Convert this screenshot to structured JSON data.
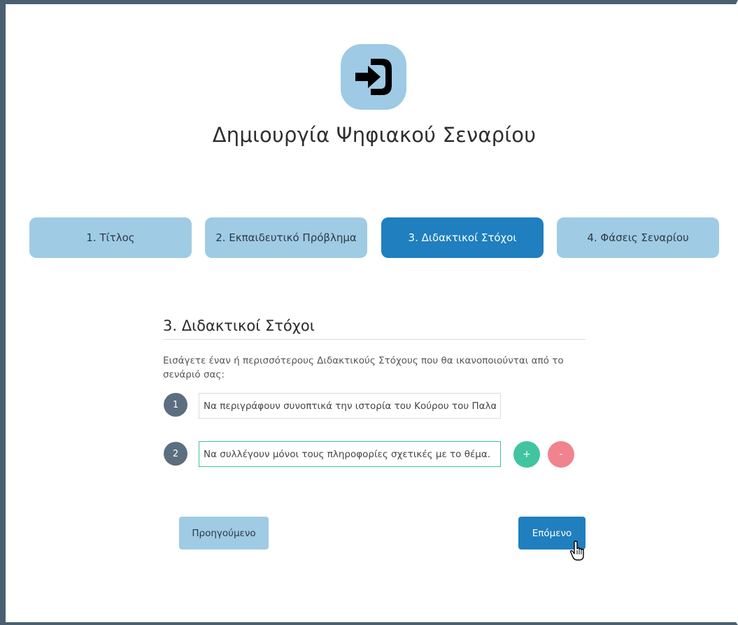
{
  "header": {
    "logo_icon": "login-arrow-icon",
    "title": "Δημιουργία Ψηφιακού Σεναρίου"
  },
  "steps": [
    {
      "label": "1. Τίτλος",
      "active": false
    },
    {
      "label": "2. Εκπαιδευτικό Πρόβλημα",
      "active": false
    },
    {
      "label": "3. Διδακτικοί Στόχοι",
      "active": true
    },
    {
      "label": "4. Φάσεις Σεναρίου",
      "active": false
    }
  ],
  "section": {
    "heading": "3. Διδακτικοί Στόχοι",
    "intro": "Εισάγετε έναν ή περισσότερους Διδακτικούς Στόχους που θα ικανοποιούνται από το σενάριό σας:"
  },
  "goals": [
    {
      "number": "1",
      "value": "Να περιγράφουν συνοπτικά την ιστορία του Κούρου του Παλαικ"
    },
    {
      "number": "2",
      "value": "Να συλλέγουν μόνοι τους πληροφορίες σχετικές με το θέμα."
    }
  ],
  "actions": {
    "add_label": "+",
    "remove_label": "-"
  },
  "nav": {
    "prev_label": "Προηγούμενο",
    "next_label": "Επόμενο"
  },
  "colors": {
    "frame": "#4a5f72",
    "tab": "#9fcbe4",
    "tab_active": "#1f7fbf",
    "add": "#42c4a0",
    "remove": "#f0838e"
  }
}
